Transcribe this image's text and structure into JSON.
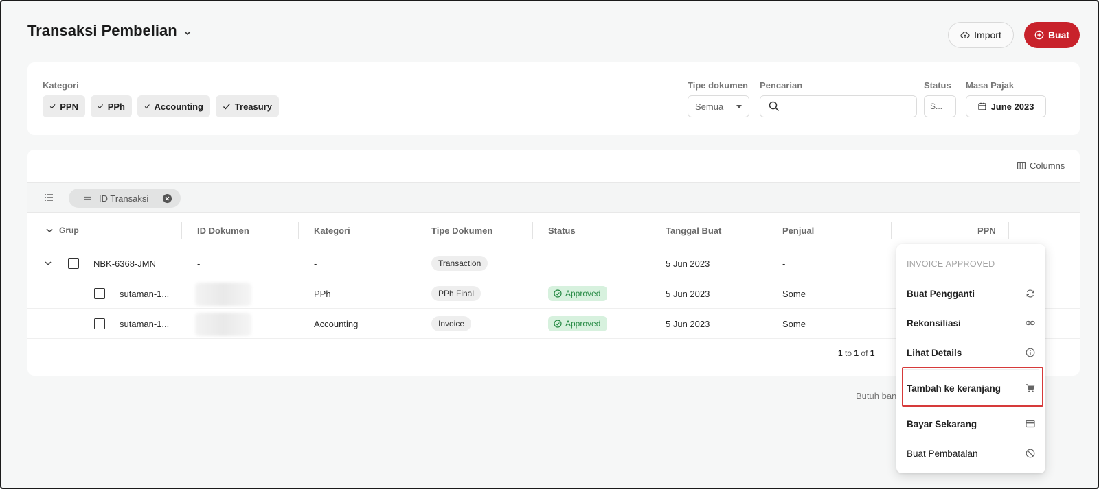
{
  "header": {
    "title": "Transaksi Pembelian",
    "import_label": "Import",
    "create_label": "Buat"
  },
  "filters": {
    "kategori_label": "Kategori",
    "kategori_chips": [
      "PPN",
      "PPh",
      "Accounting",
      "Treasury"
    ],
    "tipe_dokumen_label": "Tipe dokumen",
    "tipe_dokumen_value": "Semua",
    "pencarian_label": "Pencarian",
    "pencarian_value": "",
    "status_label": "Status",
    "status_value": "S...",
    "masa_pajak_label": "Masa Pajak",
    "masa_pajak_value": "June 2023"
  },
  "table": {
    "columns_label": "Columns",
    "group_pill_label": "ID Transaksi",
    "headers": {
      "grup": "Grup",
      "id_dokumen": "ID Dokumen",
      "kategori": "Kategori",
      "tipe_dokumen": "Tipe Dokumen",
      "status": "Status",
      "tanggal_buat": "Tanggal Buat",
      "penjual": "Penjual",
      "ppn": "PPN"
    },
    "group_row": {
      "grup": "NBK-6368-JMN",
      "id_dokumen": "-",
      "kategori": "-",
      "tipe_dokumen": "Transaction",
      "tanggal_buat": "5 Jun 2023",
      "penjual": "-"
    },
    "rows": [
      {
        "grup": "sutaman-1...",
        "kategori": "PPh",
        "tipe_dokumen": "PPh Final",
        "status": "Approved",
        "tanggal_buat": "5 Jun 2023",
        "penjual": "Some"
      },
      {
        "grup": "sutaman-1...",
        "kategori": "Accounting",
        "tipe_dokumen": "Invoice",
        "status": "Approved",
        "tanggal_buat": "5 Jun 2023",
        "penjual": "Some"
      }
    ],
    "pager": {
      "from": "1",
      "to_word": "to",
      "to": "1",
      "of_word": "of",
      "total": "1"
    }
  },
  "help_text": "Butuh bantuan",
  "context_menu": {
    "heading": "INVOICE APPROVED",
    "items": [
      {
        "label": "Buat Pengganti",
        "icon": "refresh-icon"
      },
      {
        "label": "Rekonsiliasi",
        "icon": "link-icon"
      },
      {
        "label": "Lihat Details",
        "icon": "info-icon"
      },
      {
        "label": "Tambah ke keranjang",
        "icon": "cart-icon"
      },
      {
        "label": "Bayar Sekarang",
        "icon": "credit-card-icon"
      },
      {
        "label": "Buat Pembatalan",
        "icon": "ban-icon"
      }
    ]
  },
  "colors": {
    "brand_red": "#c8222b",
    "approved_green": "#268a44",
    "approved_bg": "#d7f1de",
    "highlight_red": "#d63a3a"
  }
}
